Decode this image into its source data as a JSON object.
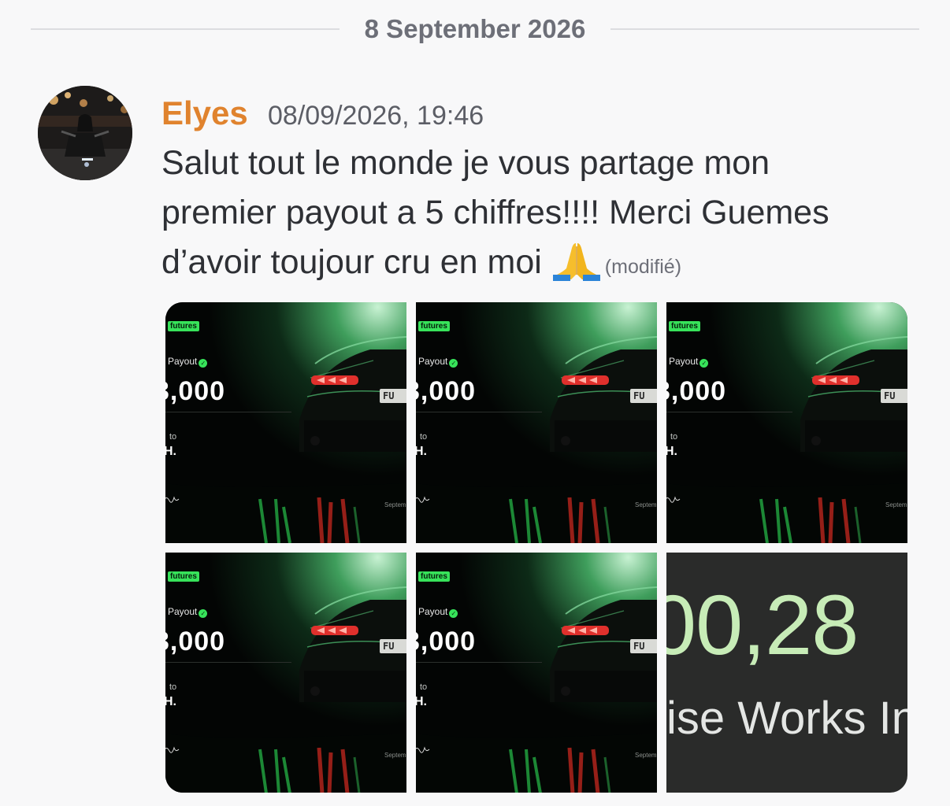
{
  "date_divider": "8 September 2026",
  "message": {
    "author": "Elyes",
    "timestamp": "08/09/2026, 19:46",
    "lines": [
      "Salut tout le monde je vous partage mon",
      "premier payout a 5 chiffres!!!! Merci Guemes",
      "d’avoir toujour cru en moi"
    ],
    "emoji": "🙏",
    "edited_label": "(modifié)",
    "author_color": "#e0832e"
  },
  "attachments": {
    "certificate": {
      "badge": "futures",
      "payout_label": "Payout",
      "amount": ",000",
      "to_label": "to",
      "recipient": "H.",
      "signature": "",
      "date_fragment": "Septem",
      "plate_text": "FU"
    },
    "last_image": {
      "amount_fragment": "00,28",
      "text_fragment": "ise Works In"
    },
    "accent_color": "#37e35a"
  }
}
